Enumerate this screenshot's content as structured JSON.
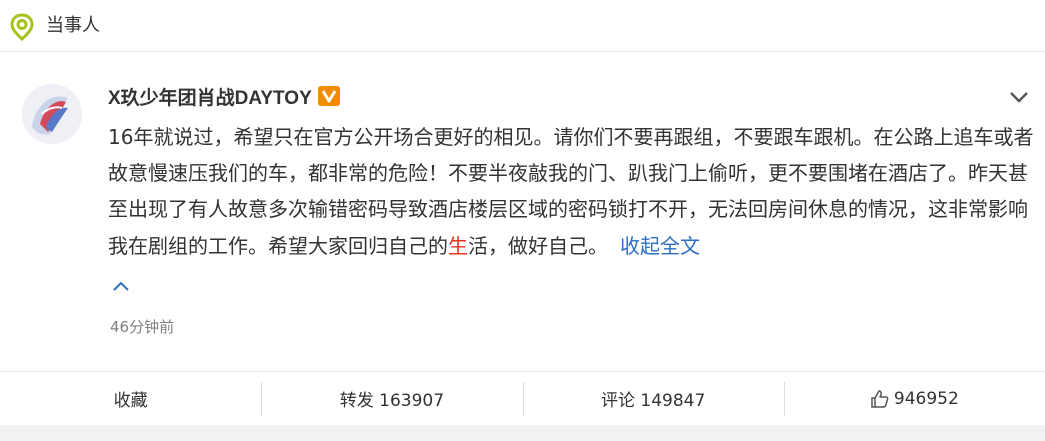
{
  "header": {
    "title": "当事人",
    "icon": "location-pin-icon"
  },
  "post": {
    "username": "X玖少年团肖战DAYTOY",
    "verified_badge": "V",
    "text_before": "16年就说过，希望只在官方公开场合更好的相见。请你们不要再跟组，不要跟车跟机。在公路上追车或者故意慢速压我们的车，都非常的危险！不要半夜敲我的门、趴我门上偷听，更不要围堵在酒店了。昨天甚至出现了有人故意多次输错密码导致酒店楼层区域的密码锁打不开，无法回房间休息的情况，这非常影响我在剧组的工作。希望大家回归自己的",
    "text_highlight": "生",
    "text_after": "活，做好自己。",
    "collapse_label": "收起全文",
    "timestamp": "46分钟前"
  },
  "actions": {
    "favorite_label": "收藏",
    "repost_label": "转发 163907",
    "comment_label": "评论 149847",
    "like_count": "946952"
  },
  "colors": {
    "link": "#2d6ec4",
    "highlight": "#e8331f",
    "header_icon": "#b4c81e",
    "badge": "#f08c00"
  }
}
